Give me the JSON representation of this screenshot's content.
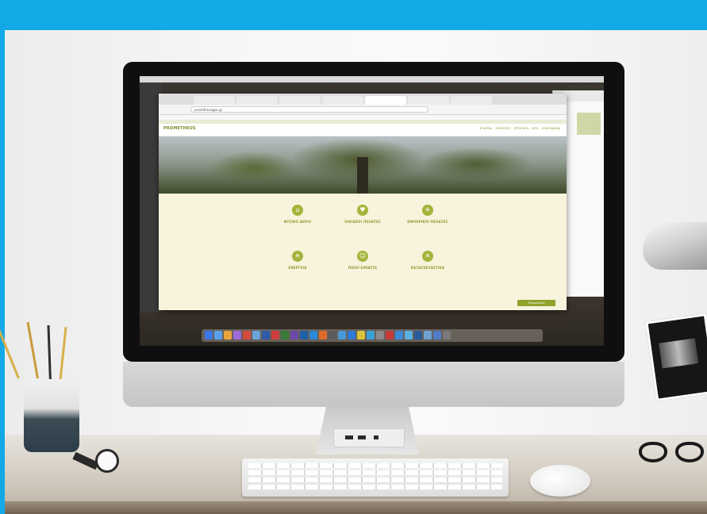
{
  "site": {
    "logo": "PROMETHEUS",
    "url": "promitheusgas.gr",
    "nav": [
      "ΕΤΑΙΡΕΙΑ",
      "ΥΠΗΡΕΣΙΕΣ",
      "ΠΡΟΪΟΝΤΑ",
      "ΕΡΓΑ",
      "ΕΠΙΚΟΙΝΩΝΙΑ"
    ],
    "services": [
      {
        "icon": "factory-icon",
        "glyph": "⌂",
        "label": "ΦΥΣΙΚΟ ΑΕΡΙΟ"
      },
      {
        "icon": "family-icon",
        "glyph": "♥",
        "label": "ΟΙΚΙΑΚΟΙ ΠΕΛΑΤΕΣ"
      },
      {
        "icon": "rocket-icon",
        "glyph": "✈",
        "label": "ΕΜΠΟΡΙΚΟΙ ΠΕΛΑΤΕΣ"
      },
      {
        "icon": "lightbulb-icon",
        "glyph": "☀",
        "label": "ΕΝΕΡΓΕΙΑ"
      },
      {
        "icon": "people-icon",
        "glyph": "☺",
        "label": "ΠΟΙΟΙ ΕΙΜΑΣΤΕ"
      },
      {
        "icon": "tools-icon",
        "glyph": "✕",
        "label": "ΚΑΤΑΣΚΕΥΑΣΤΙΚΑ"
      }
    ],
    "cta_label": "Επικοινωνία"
  },
  "colors": {
    "frame_blue": "#12a9e6",
    "brand_green": "#a3b43a",
    "services_bg": "#f7f3dc"
  },
  "dock_colors": [
    "#3b78e7",
    "#5aa0e8",
    "#e8a33b",
    "#9c6adb",
    "#d64a3a",
    "#6aa4d8",
    "#2f5aa8",
    "#cf3e3e",
    "#3a7a3a",
    "#6a4aa8",
    "#1d5fa8",
    "#2a88d8",
    "#e06a2a",
    "#5b5b5b",
    "#4a9ad8",
    "#2d7bd6",
    "#d9c33b",
    "#3aa0d8",
    "#8a8a8a",
    "#c73a3a",
    "#3e8ad6",
    "#5ab0e0",
    "#2b5a9a",
    "#6fa0d0",
    "#4f7ac8",
    "#7a7a7a"
  ]
}
